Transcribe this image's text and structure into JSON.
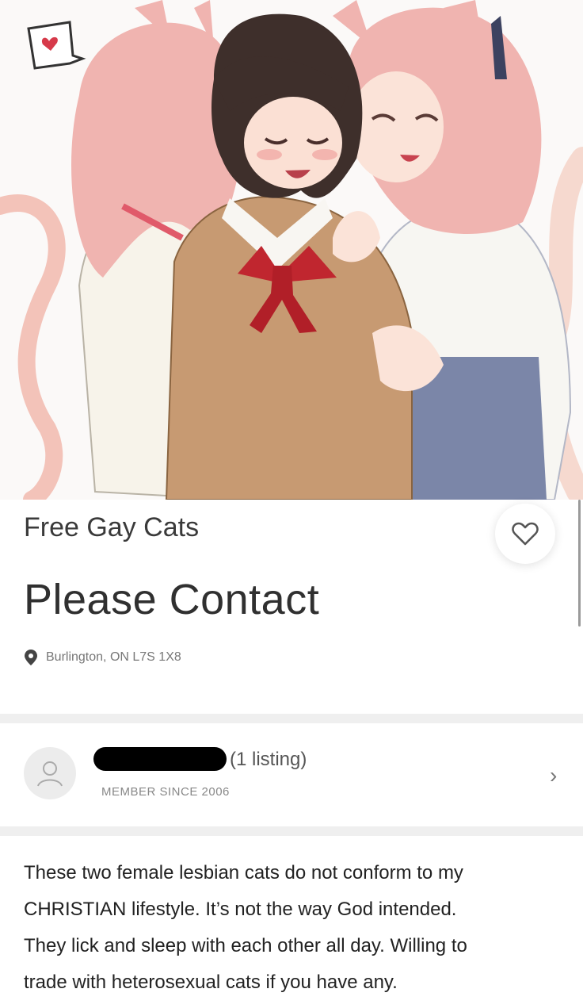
{
  "listing": {
    "title": "Free Gay Cats",
    "price": "Please Contact",
    "location": "Burlington, ON L7S 1X8",
    "favorite_icon": "heart-outline-icon"
  },
  "seller": {
    "listing_count": "(1 listing)",
    "member_since": "MEMBER SINCE 2006",
    "avatar_icon": "user-avatar-icon",
    "chevron_icon": "chevron-right-icon"
  },
  "description": {
    "lines": [
      "These two female lesbian cats do not conform to my",
      "CHRISTIAN lifestyle. It’s not the way God intended.",
      "They lick and sleep with each other all day. Willing to",
      "trade with heterosexual cats if you have any."
    ]
  },
  "colors": {
    "hair_pink": "#f0b4b0",
    "hair_brown": "#3e2f2b",
    "cardigan": "#c79a72",
    "bow_red": "#c0262f",
    "skirt_blue": "#7b86a8"
  }
}
